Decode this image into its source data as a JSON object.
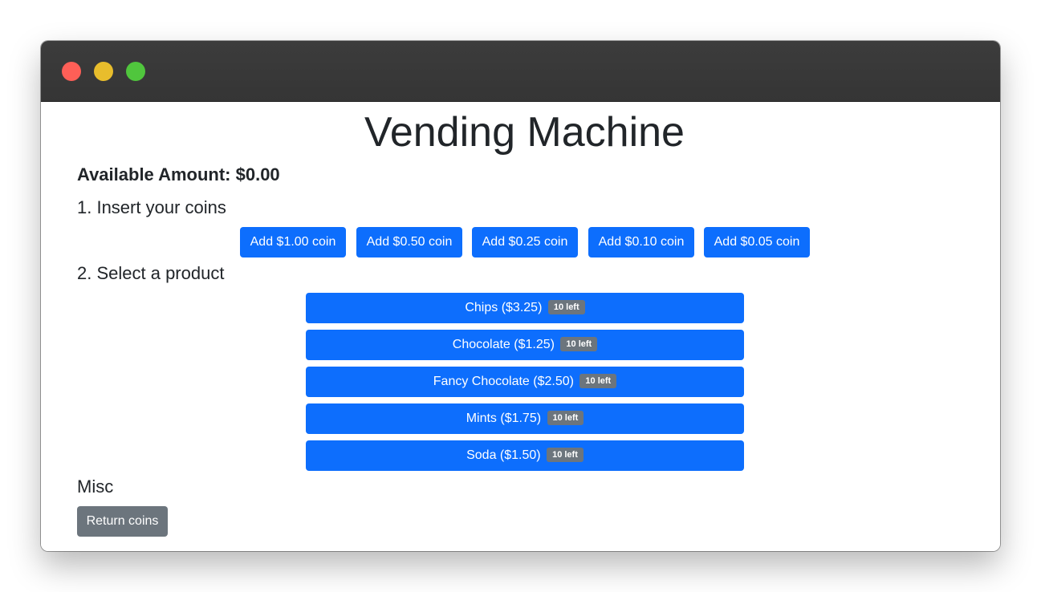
{
  "window": {
    "traffic_lights": [
      "close",
      "minimize",
      "zoom"
    ]
  },
  "page": {
    "title": "Vending Machine",
    "available_amount": "Available Amount: $0.00"
  },
  "coins": {
    "heading": "1. Insert your coins",
    "buttons": [
      {
        "label": "Add $1.00 coin"
      },
      {
        "label": "Add $0.50 coin"
      },
      {
        "label": "Add $0.25 coin"
      },
      {
        "label": "Add $0.10 coin"
      },
      {
        "label": "Add $0.05 coin"
      }
    ]
  },
  "products": {
    "heading": "2. Select a product",
    "items": [
      {
        "label": "Chips ($3.25)",
        "stock": "10 left"
      },
      {
        "label": "Chocolate ($1.25)",
        "stock": "10 left"
      },
      {
        "label": "Fancy Chocolate ($2.50)",
        "stock": "10 left"
      },
      {
        "label": "Mints ($1.75)",
        "stock": "10 left"
      },
      {
        "label": "Soda ($1.50)",
        "stock": "10 left"
      }
    ]
  },
  "misc": {
    "heading": "Misc",
    "return_label": "Return coins"
  },
  "colors": {
    "primary": "#0d6efd",
    "secondary": "#6c757d",
    "titlebar": "#393939",
    "close": "#fe5f57",
    "minimize": "#e8bd2c",
    "zoom": "#50c63d"
  }
}
